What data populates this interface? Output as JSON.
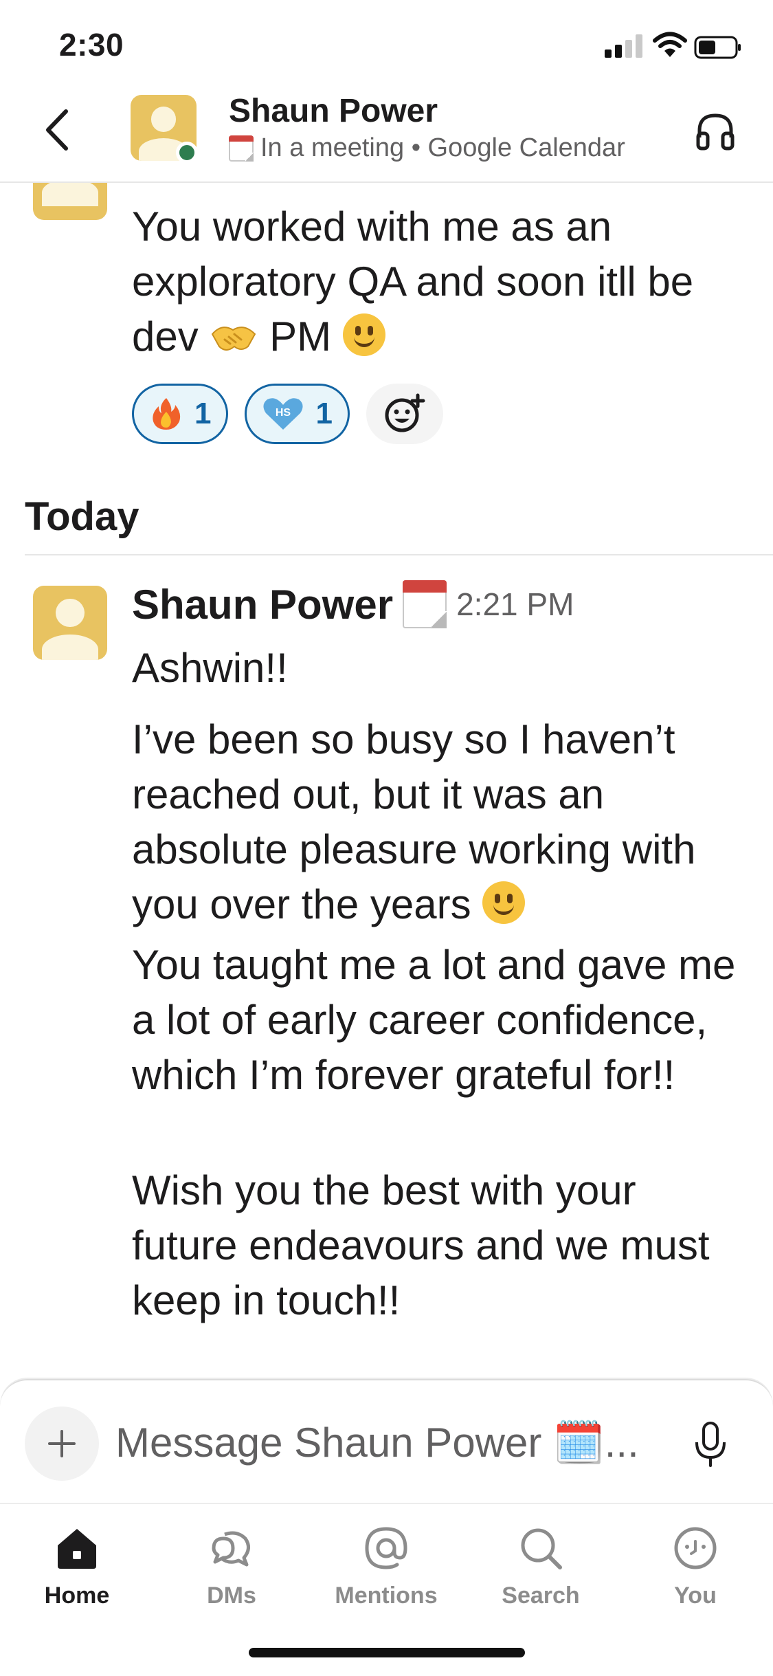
{
  "status_bar": {
    "time": "2:30"
  },
  "header": {
    "contact_name": "Shaun Power",
    "status_text": "In a meeting • Google Calendar",
    "presence_color": "#2e7d4f"
  },
  "previous_message": {
    "text": "You worked with me as an exploratory QA and soon itll be dev",
    "text_end": "PM",
    "reactions": [
      {
        "emoji": "fire",
        "count": "1"
      },
      {
        "emoji": "hs-heart",
        "count": "1"
      }
    ]
  },
  "divider": {
    "label": "Today"
  },
  "message": {
    "author": "Shaun Power",
    "time": "2:21 PM",
    "paragraphs": [
      "Ashwin!!",
      "I’ve been so busy so I haven’t reached out, but it was an absolute pleasure working with you over the years",
      "You taught me a lot and gave me a lot of early career confidence, which I’m forever grateful for!!",
      "Wish you the best with your future endeavours and we must keep in touch!!"
    ]
  },
  "composer": {
    "placeholder": "Message Shaun Power 🗓️..."
  },
  "tabs": [
    {
      "label": "Home",
      "icon": "home-icon",
      "active": true
    },
    {
      "label": "DMs",
      "icon": "dms-icon"
    },
    {
      "label": "Mentions",
      "icon": "mentions-icon"
    },
    {
      "label": "Search",
      "icon": "search-icon"
    },
    {
      "label": "You",
      "icon": "you-icon"
    }
  ],
  "colors": {
    "accent": "#1264a3",
    "avatar": "#e8c361",
    "reaction_bg": "#e8f5fa"
  }
}
